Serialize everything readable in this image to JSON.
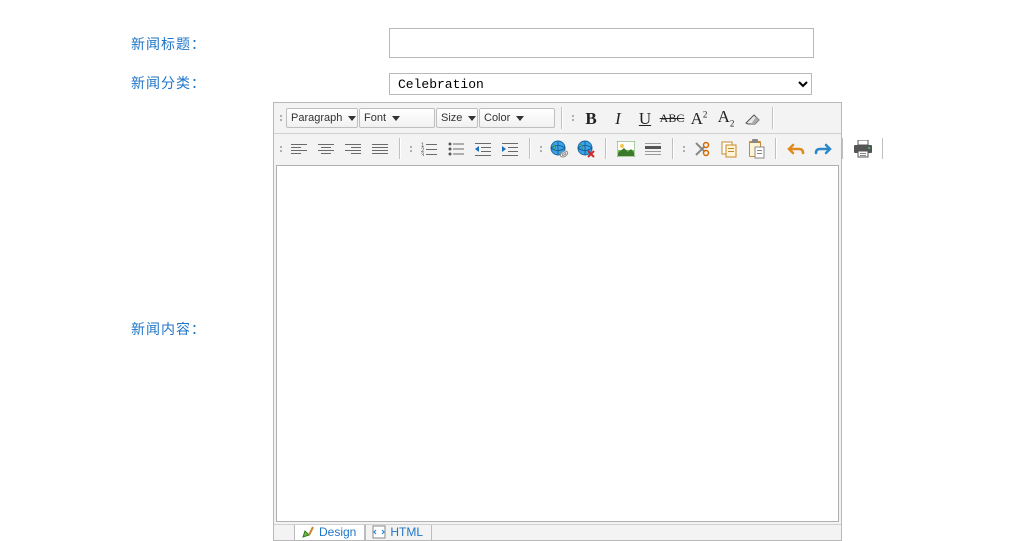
{
  "labels": {
    "title": "新闻标题：",
    "category": "新闻分类：",
    "content": "新闻内容："
  },
  "fields": {
    "title_value": "",
    "category_value": "Celebration"
  },
  "editor": {
    "dropdowns": {
      "paragraph": "Paragraph",
      "font": "Font",
      "size": "Size",
      "color": "Color"
    },
    "tabs": {
      "design": "Design",
      "html": "HTML"
    }
  }
}
